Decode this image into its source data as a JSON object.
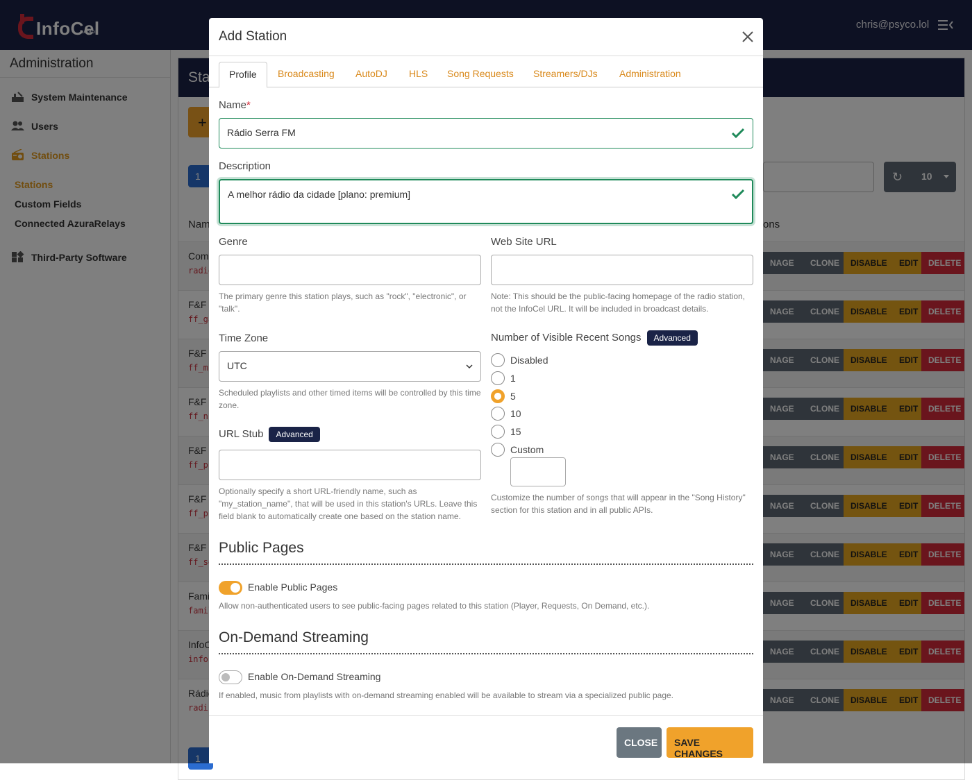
{
  "app": {
    "logo_text": "InfoCel",
    "logo_sub": "RÁDIOS",
    "user_email": "chris@psyco.lol"
  },
  "sidebar": {
    "title": "Administration",
    "items": [
      {
        "label": "System Maintenance",
        "icon": "maintenance-icon"
      },
      {
        "label": "Users",
        "icon": "users-icon"
      },
      {
        "label": "Stations",
        "icon": "radio-icon"
      },
      {
        "label": "Third-Party Software",
        "icon": "apps-icon"
      }
    ],
    "sub_items": [
      "Stations",
      "Custom Fields",
      "Connected AzuraRelays"
    ]
  },
  "page": {
    "header_title": "Sta",
    "add_label": "+",
    "page_number": "1",
    "per_page": "10",
    "col_name": "Nam",
    "col_actions": "ons",
    "rows": [
      {
        "name": "Comp",
        "short": "radio"
      },
      {
        "name": "F&F C",
        "short": "ff_ga"
      },
      {
        "name": "F&F N",
        "short": "ff_mp"
      },
      {
        "name": "F&F N",
        "short": "ff_nc"
      },
      {
        "name": "F&F P",
        "short": "ff_pc"
      },
      {
        "name": "F&F P",
        "short": "ff_pr"
      },
      {
        "name": "F&F S",
        "short": "ff_se"
      },
      {
        "name": "Fami",
        "short": "famil"
      },
      {
        "name": "InfoC",
        "short": "infoc"
      },
      {
        "name": "Rádio",
        "short": "radic"
      }
    ],
    "actions": {
      "manage": "NAGE",
      "clone": "CLONE",
      "disable": "DISABLE",
      "edit": "EDIT",
      "delete": "DELETE"
    }
  },
  "modal": {
    "title": "Add Station",
    "tabs": [
      "Profile",
      "Broadcasting",
      "AutoDJ",
      "HLS",
      "Song Requests",
      "Streamers/DJs",
      "Administration"
    ],
    "name_label": "Name",
    "name_required": "*",
    "name_value": "Rádio Serra FM",
    "description_label": "Description",
    "description_value": "A melhor rádio da cidade [plano: premium]",
    "genre_label": "Genre",
    "genre_value": "",
    "genre_help": "The primary genre this station plays, such as \"rock\", \"electronic\", or \"talk\".",
    "website_label": "Web Site URL",
    "website_value": "",
    "website_help": "Note: This should be the public-facing homepage of the radio station, not the InfoCel URL. It will be included in broadcast details.",
    "timezone_label": "Time Zone",
    "timezone_value": "UTC",
    "timezone_help": "Scheduled playlists and other timed items will be controlled by this time zone.",
    "urlstub_label": "URL Stub",
    "urlstub_badge": "Advanced",
    "urlstub_value": "",
    "urlstub_help": "Optionally specify a short URL-friendly name, such as \"my_station_name\", that will be used in this station's URLs. Leave this field blank to automatically create one based on the station name.",
    "recent_songs_label": "Number of Visible Recent Songs",
    "recent_songs_badge": "Advanced",
    "recent_songs_options": [
      "Disabled",
      "1",
      "5",
      "10",
      "15",
      "Custom"
    ],
    "recent_songs_selected": "5",
    "recent_songs_custom_value": "",
    "recent_songs_help": "Customize the number of songs that will appear in the \"Song History\" section for this station and in all public APIs.",
    "public_pages_title": "Public Pages",
    "public_pages_toggle_label": "Enable Public Pages",
    "public_pages_enabled": true,
    "public_pages_help": "Allow non-authenticated users to see public-facing pages related to this station (Player, Requests, On Demand, etc.).",
    "ondemand_title": "On-Demand Streaming",
    "ondemand_toggle_label": "Enable On-Demand Streaming",
    "ondemand_enabled": false,
    "ondemand_help": "If enabled, music from playlists with on-demand streaming enabled will be available to stream via a specialized public page.",
    "close_label": "CLOSE",
    "save_label": "SAVE CHANGES"
  },
  "colors": {
    "navy": "#1a2347",
    "accent": "#f0a22b",
    "danger": "#d52b3a",
    "valid": "#1f8a5a",
    "secondary": "#6b7780"
  }
}
